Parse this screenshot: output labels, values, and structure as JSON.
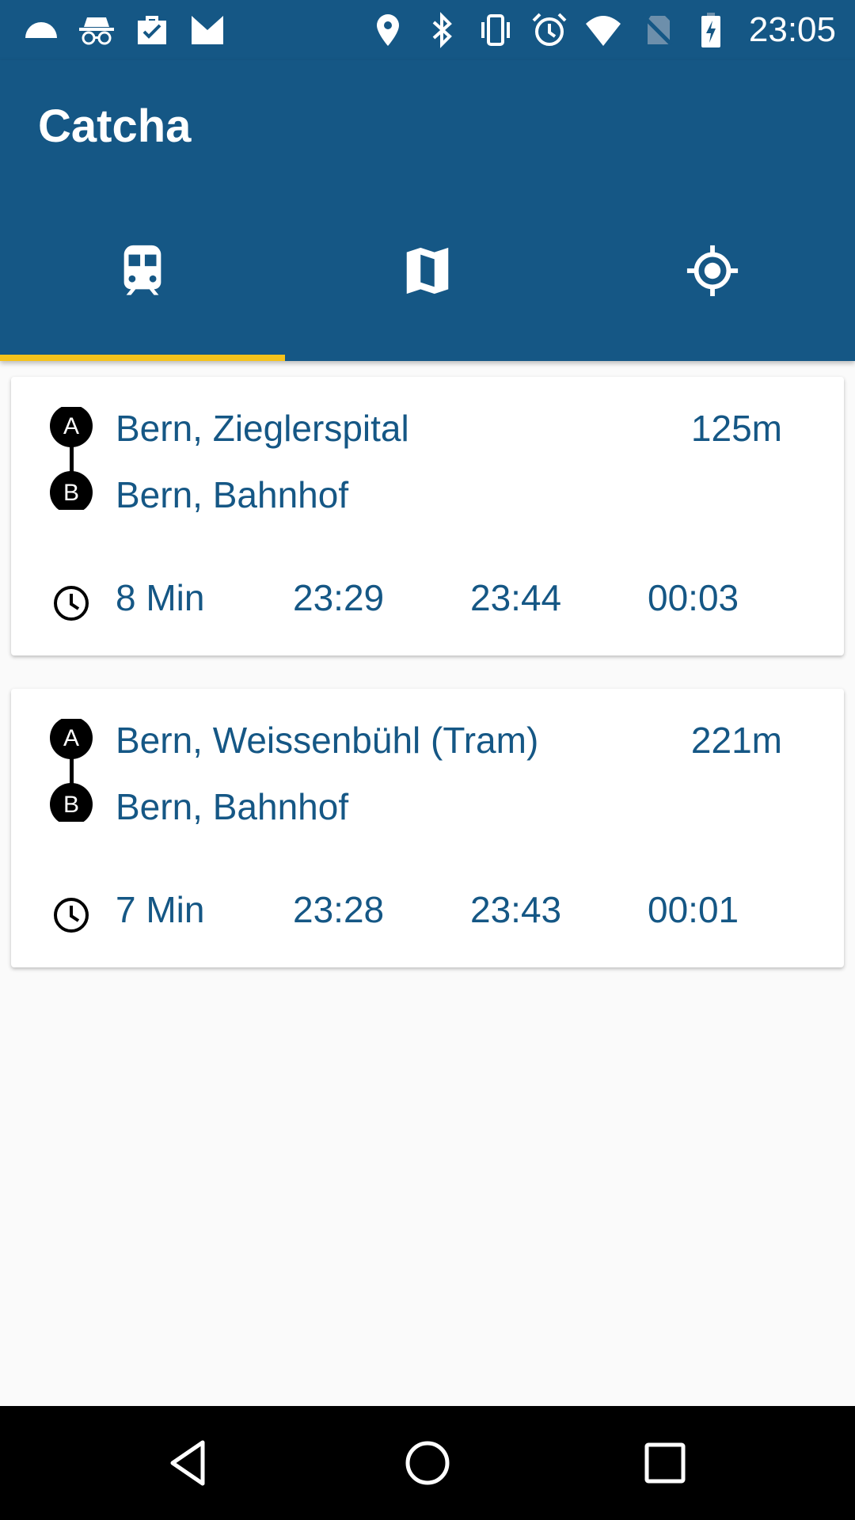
{
  "status_bar": {
    "time": "23:05",
    "left_icons": [
      "cloud-icon",
      "incognito-icon",
      "briefcase-check-icon",
      "gmail-icon"
    ],
    "right_icons": [
      "location-icon",
      "bluetooth-icon",
      "vibrate-icon",
      "alarm-icon",
      "wifi-icon",
      "no-sim-icon",
      "battery-charging-icon"
    ]
  },
  "app_bar": {
    "title": "Catcha",
    "tabs": [
      {
        "icon": "train-icon",
        "active": true
      },
      {
        "icon": "map-icon",
        "active": false
      },
      {
        "icon": "location-target-icon",
        "active": false
      }
    ]
  },
  "connections": [
    {
      "from": "Bern, Zieglerspital",
      "to": "Bern, Bahnhof",
      "distance": "125m",
      "walk": "8 Min",
      "departures": [
        "23:29",
        "23:44",
        "00:03"
      ]
    },
    {
      "from": "Bern, Weissenbühl (Tram)",
      "to": "Bern, Bahnhof",
      "distance": "221m",
      "walk": "7 Min",
      "departures": [
        "23:28",
        "23:43",
        "00:01"
      ]
    }
  ],
  "nav_bar": {
    "icons": [
      "back-icon",
      "home-icon",
      "recents-icon"
    ]
  },
  "colors": {
    "primary": "#155785",
    "accent": "#f5c21b",
    "background": "#fafafa"
  }
}
